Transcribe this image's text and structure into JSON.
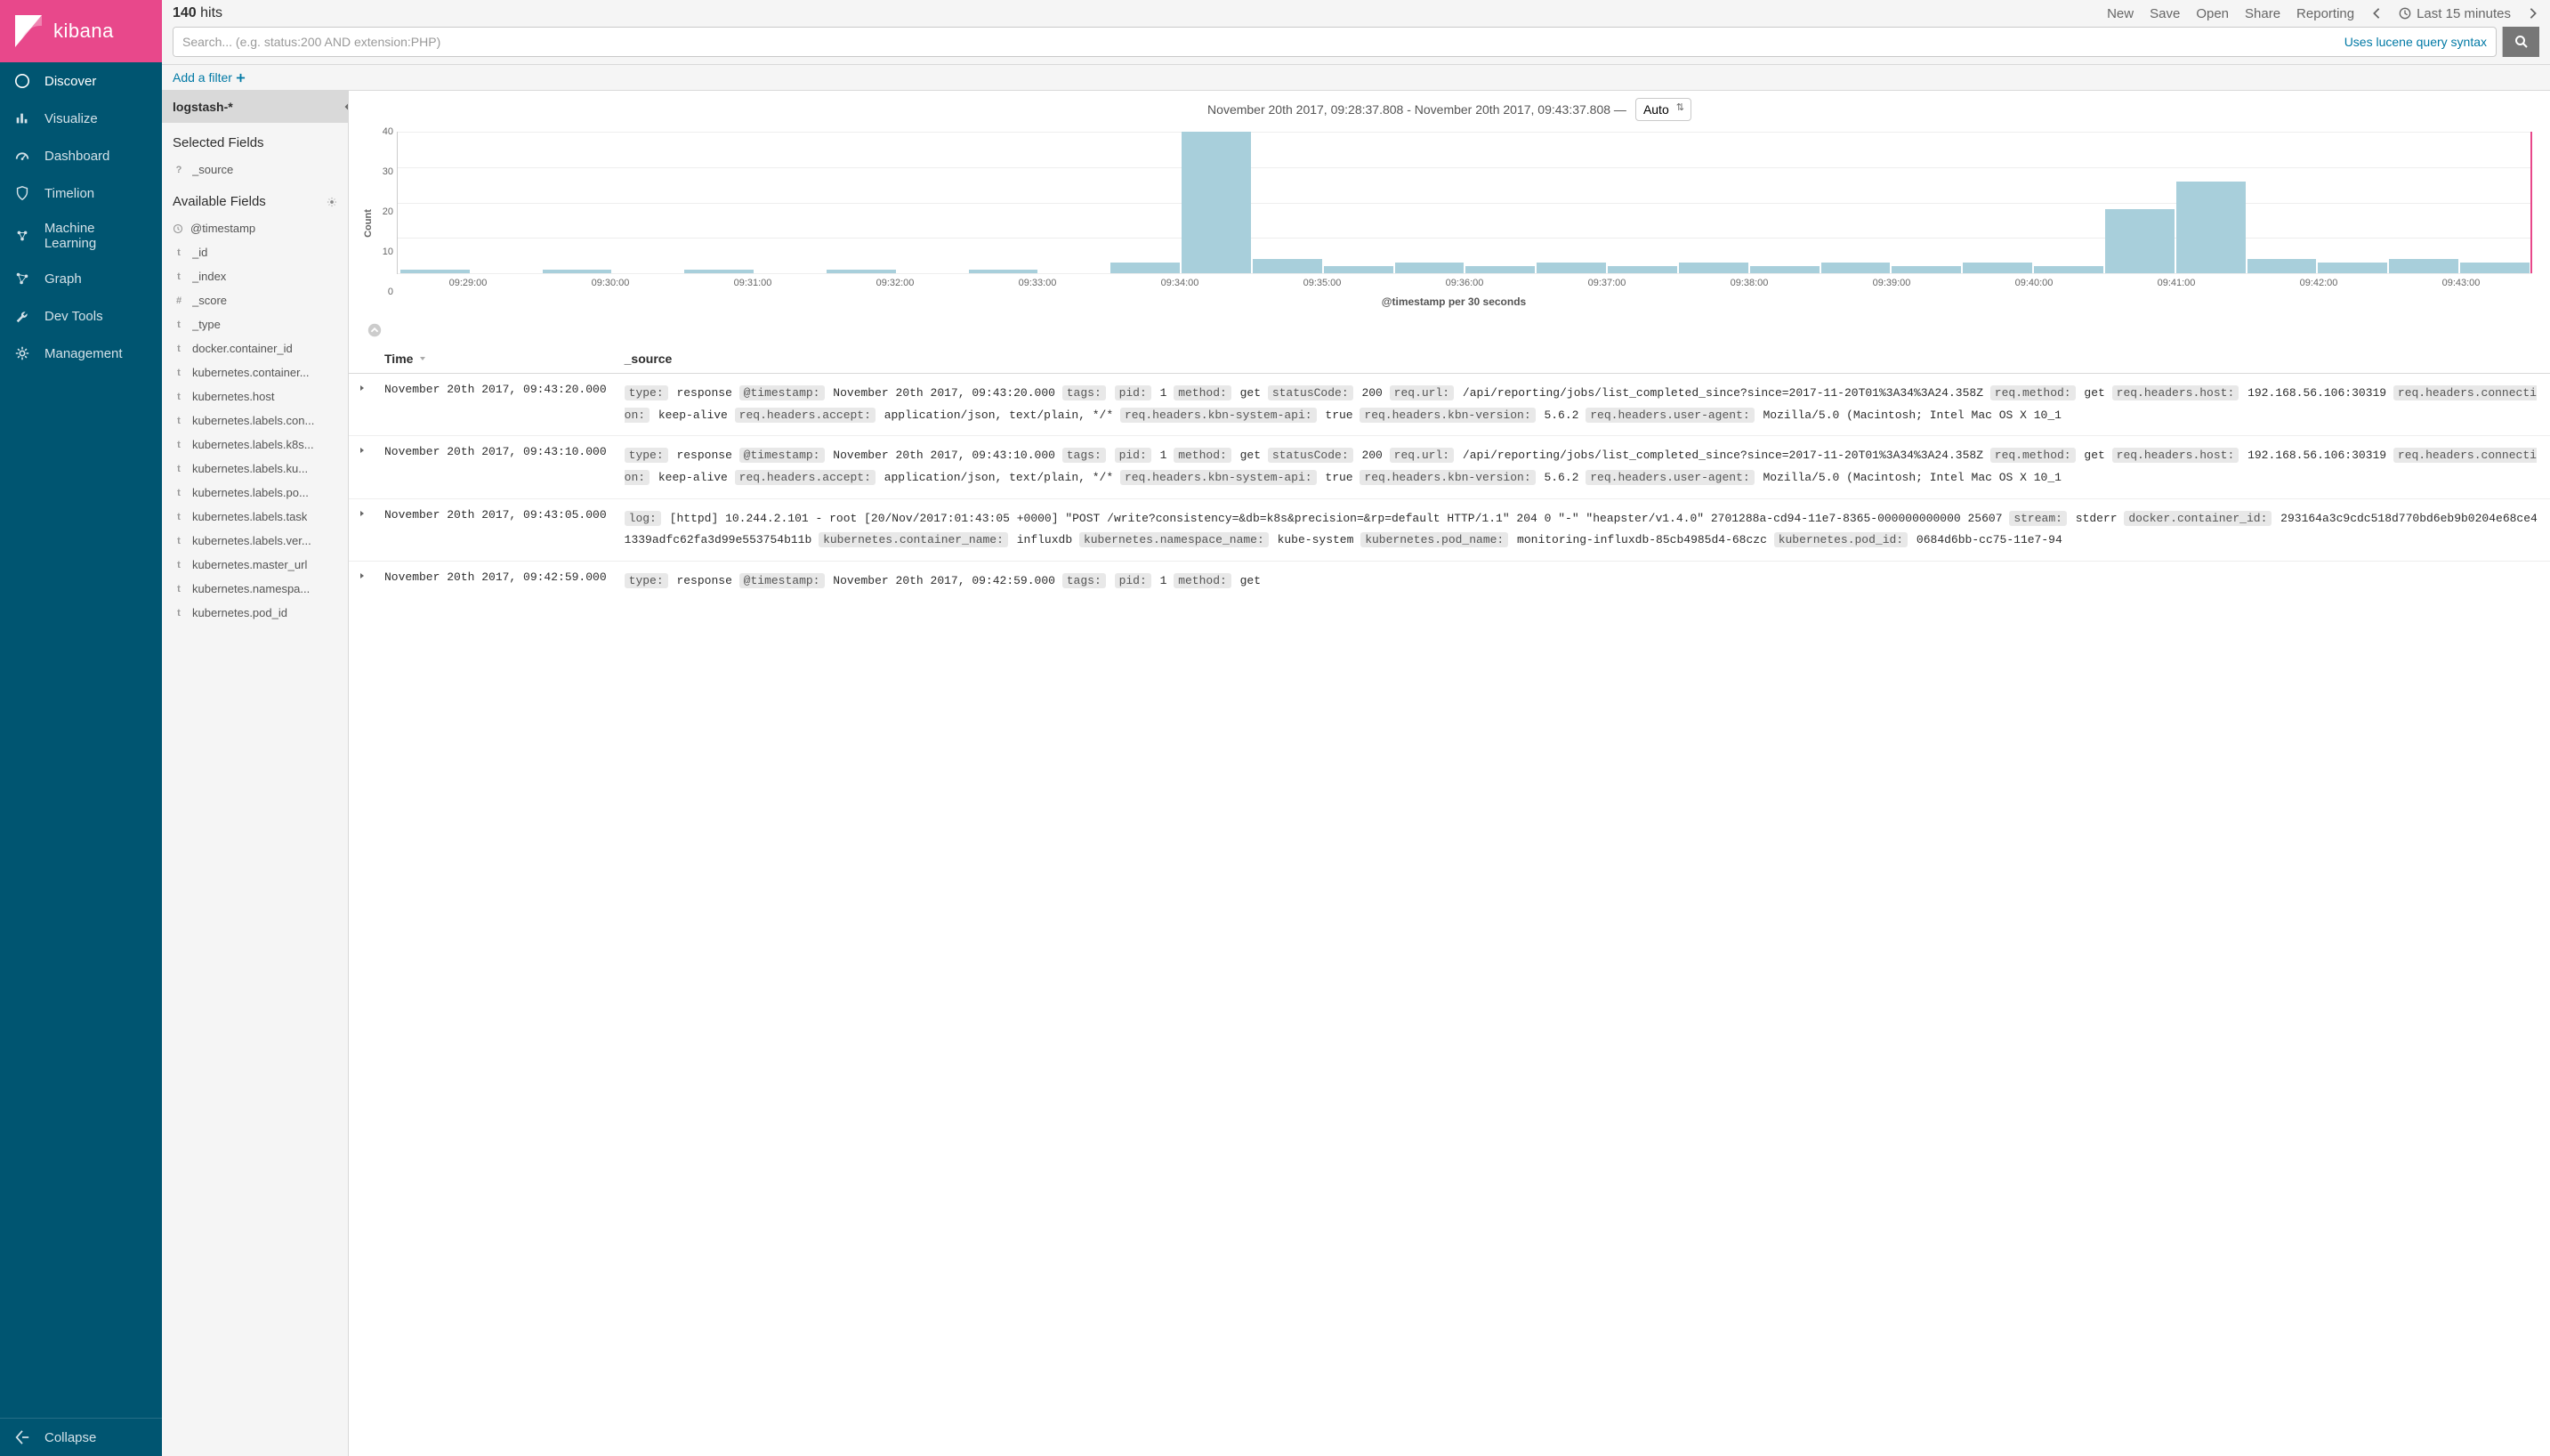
{
  "brand": {
    "name": "kibana"
  },
  "nav": {
    "items": [
      {
        "label": "Discover",
        "icon": "compass",
        "active": true
      },
      {
        "label": "Visualize",
        "icon": "bar-chart"
      },
      {
        "label": "Dashboard",
        "icon": "gauge"
      },
      {
        "label": "Timelion",
        "icon": "shield"
      },
      {
        "label": "Machine Learning",
        "icon": "ml"
      },
      {
        "label": "Graph",
        "icon": "graph"
      },
      {
        "label": "Dev Tools",
        "icon": "wrench"
      },
      {
        "label": "Management",
        "icon": "gear"
      }
    ],
    "collapse": "Collapse"
  },
  "topbar": {
    "hits_count": "140",
    "hits_label": "hits",
    "actions": [
      "New",
      "Save",
      "Open",
      "Share",
      "Reporting"
    ],
    "time_range": "Last 15 minutes",
    "search_placeholder": "Search... (e.g. status:200 AND extension:PHP)",
    "lucene_link": "Uses lucene query syntax",
    "add_filter": "Add a filter"
  },
  "fields": {
    "index_pattern": "logstash-*",
    "selected_title": "Selected Fields",
    "selected": [
      {
        "type": "?",
        "name": "_source"
      }
    ],
    "available_title": "Available Fields",
    "available": [
      {
        "type": "clock",
        "name": "@timestamp"
      },
      {
        "type": "t",
        "name": "_id"
      },
      {
        "type": "t",
        "name": "_index"
      },
      {
        "type": "#",
        "name": "_score"
      },
      {
        "type": "t",
        "name": "_type"
      },
      {
        "type": "t",
        "name": "docker.container_id"
      },
      {
        "type": "t",
        "name": "kubernetes.container..."
      },
      {
        "type": "t",
        "name": "kubernetes.host"
      },
      {
        "type": "t",
        "name": "kubernetes.labels.con..."
      },
      {
        "type": "t",
        "name": "kubernetes.labels.k8s..."
      },
      {
        "type": "t",
        "name": "kubernetes.labels.ku..."
      },
      {
        "type": "t",
        "name": "kubernetes.labels.po..."
      },
      {
        "type": "t",
        "name": "kubernetes.labels.task"
      },
      {
        "type": "t",
        "name": "kubernetes.labels.ver..."
      },
      {
        "type": "t",
        "name": "kubernetes.master_url"
      },
      {
        "type": "t",
        "name": "kubernetes.namespa..."
      },
      {
        "type": "t",
        "name": "kubernetes.pod_id"
      }
    ]
  },
  "results": {
    "date_range": "November 20th 2017, 09:28:37.808 - November 20th 2017, 09:43:37.808 —",
    "interval": "Auto",
    "chart_xlabel": "@timestamp per 30 seconds",
    "chart_ylabel": "Count",
    "columns": {
      "time": "Time",
      "source": "_source"
    },
    "docs": [
      {
        "time": "November 20th 2017, 09:43:20.000",
        "kv": [
          [
            "type:",
            "response"
          ],
          [
            "@timestamp:",
            "November 20th 2017, 09:43:20.000"
          ],
          [
            "tags:",
            ""
          ],
          [
            "pid:",
            "1"
          ],
          [
            "method:",
            "get"
          ],
          [
            "statusCode:",
            "200"
          ],
          [
            "req.url:",
            "/api/reporting/jobs/list_completed_since?since=2017-11-20T01%3A34%3A24.358Z"
          ],
          [
            "req.method:",
            "get"
          ],
          [
            "req.headers.host:",
            "192.168.56.106:30319"
          ],
          [
            "req.headers.connection:",
            "keep-alive"
          ],
          [
            "req.headers.accept:",
            "application/json, text/plain, */*"
          ],
          [
            "req.headers.kbn-system-api:",
            "true"
          ],
          [
            "req.headers.kbn-version:",
            "5.6.2"
          ],
          [
            "req.headers.user-agent:",
            "Mozilla/5.0 (Macintosh; Intel Mac OS X 10_1"
          ]
        ]
      },
      {
        "time": "November 20th 2017, 09:43:10.000",
        "kv": [
          [
            "type:",
            "response"
          ],
          [
            "@timestamp:",
            "November 20th 2017, 09:43:10.000"
          ],
          [
            "tags:",
            ""
          ],
          [
            "pid:",
            "1"
          ],
          [
            "method:",
            "get"
          ],
          [
            "statusCode:",
            "200"
          ],
          [
            "req.url:",
            "/api/reporting/jobs/list_completed_since?since=2017-11-20T01%3A34%3A24.358Z"
          ],
          [
            "req.method:",
            "get"
          ],
          [
            "req.headers.host:",
            "192.168.56.106:30319"
          ],
          [
            "req.headers.connection:",
            "keep-alive"
          ],
          [
            "req.headers.accept:",
            "application/json, text/plain, */*"
          ],
          [
            "req.headers.kbn-system-api:",
            "true"
          ],
          [
            "req.headers.kbn-version:",
            "5.6.2"
          ],
          [
            "req.headers.user-agent:",
            "Mozilla/5.0 (Macintosh; Intel Mac OS X 10_1"
          ]
        ]
      },
      {
        "time": "November 20th 2017, 09:43:05.000",
        "kv": [
          [
            "log:",
            "[httpd] 10.244.2.101 - root [20/Nov/2017:01:43:05 +0000] \"POST /write?consistency=&db=k8s&precision=&rp=default HTTP/1.1\" 204 0 \"-\" \"heapster/v1.4.0\" 2701288a-cd94-11e7-8365-000000000000 25607"
          ],
          [
            "stream:",
            "stderr"
          ],
          [
            "docker.container_id:",
            "293164a3c9cdc518d770bd6eb9b0204e68ce41339adfc62fa3d99e553754b11b"
          ],
          [
            "kubernetes.container_name:",
            "influxdb"
          ],
          [
            "kubernetes.namespace_name:",
            "kube-system"
          ],
          [
            "kubernetes.pod_name:",
            "monitoring-influxdb-85cb4985d4-68czc"
          ],
          [
            "kubernetes.pod_id:",
            "0684d6bb-cc75-11e7-94"
          ]
        ]
      },
      {
        "time": "November 20th 2017, 09:42:59.000",
        "kv": [
          [
            "type:",
            "response"
          ],
          [
            "@timestamp:",
            "November 20th 2017, 09:42:59.000"
          ],
          [
            "tags:",
            ""
          ],
          [
            "pid:",
            "1"
          ],
          [
            "method:",
            "get"
          ]
        ]
      }
    ]
  },
  "chart_data": {
    "type": "bar",
    "title": "",
    "xlabel": "@timestamp per 30 seconds",
    "ylabel": "Count",
    "ylim": [
      0,
      40
    ],
    "yticks": [
      0,
      10,
      20,
      30,
      40
    ],
    "categories": [
      "09:29:00",
      "",
      "09:30:00",
      "",
      "09:31:00",
      "",
      "09:32:00",
      "",
      "09:33:00",
      "",
      "09:34:00",
      "",
      "09:35:00",
      "",
      "09:36:00",
      "",
      "09:37:00",
      "",
      "09:38:00",
      "",
      "09:39:00",
      "",
      "09:40:00",
      "",
      "09:41:00",
      "",
      "09:42:00",
      "",
      "09:43:00",
      ""
    ],
    "values": [
      1,
      0,
      1,
      0,
      1,
      0,
      1,
      0,
      1,
      0,
      3,
      40,
      4,
      2,
      3,
      2,
      3,
      2,
      3,
      2,
      3,
      2,
      3,
      2,
      18,
      26,
      4,
      3,
      4,
      3
    ]
  }
}
